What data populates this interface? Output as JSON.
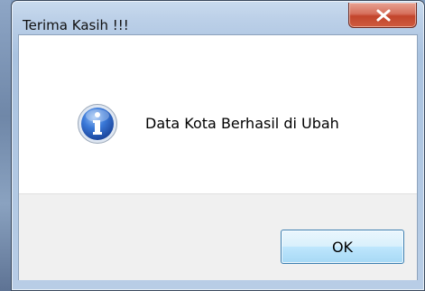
{
  "dialog": {
    "title": "Terima Kasih !!!",
    "message": "Data Kota Berhasil di Ubah",
    "ok_label": "OK",
    "icon": "information-icon",
    "close_icon": "close-icon"
  },
  "colors": {
    "title_bar": "#bcd0e8",
    "close_button": "#c2452c",
    "client_background": "#ffffff",
    "button_bar": "#f0f0f0",
    "ok_button_border": "#3c7fb1",
    "info_icon": "#2a64c5"
  }
}
